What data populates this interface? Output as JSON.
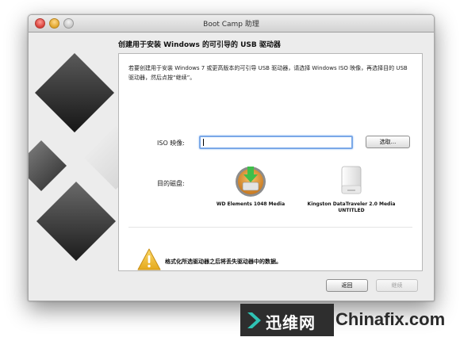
{
  "window": {
    "title": "Boot Camp 助理"
  },
  "heading": "创建用于安装 Windows 的可引导的 USB 驱动器",
  "description": "若要创建用于安装 Windows 7 或更高版本的可引导 USB 驱动器，请选择 Windows ISO 映像，再选择目的 USB 驱动器，然后点按“继续”。",
  "iso": {
    "label": "ISO 映像:",
    "value": "",
    "browse_label": "选取..."
  },
  "target": {
    "label": "目的磁盘:"
  },
  "disks": [
    {
      "name": "WD Elements 1048 Media",
      "subtitle": "",
      "icon": "external-drive-icon"
    },
    {
      "name": "Kingston DataTraveler 2.0 Media",
      "subtitle": "UNTITLED",
      "icon": "usb-drive-icon"
    }
  ],
  "warning": {
    "text": "格式化所选驱动器之后将丢失驱动器中的数据。",
    "icon": "warning-icon"
  },
  "buttons": {
    "back": "返回",
    "continue": "继续"
  },
  "watermark": {
    "cn": "迅维网",
    "en": "Chinafix.com"
  },
  "colors": {
    "accent": "#7aa8e8",
    "warning": "#f2c230"
  }
}
